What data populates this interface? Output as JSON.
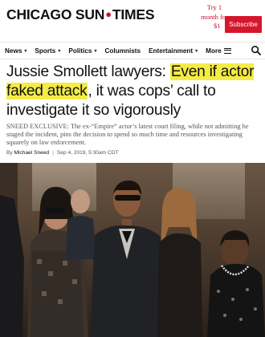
{
  "header": {
    "logo_left": "CHICAGO SUN",
    "logo_dot": "●",
    "logo_right": "TIMES",
    "promo_line1": "Try 1",
    "promo_line2": "month for",
    "promo_line3": "$1",
    "subscribe_label": "Subscribe"
  },
  "nav": {
    "items": [
      {
        "label": "News",
        "chevron": true
      },
      {
        "label": "Sports",
        "chevron": true
      },
      {
        "label": "Politics",
        "chevron": true
      },
      {
        "label": "Columnists",
        "chevron": false
      },
      {
        "label": "Entertainment",
        "chevron": true
      },
      {
        "label": "More",
        "chevron": false
      }
    ],
    "chevron_glyph": "▾"
  },
  "article": {
    "headline_part1": "Jussie Smollett lawyers: ",
    "headline_highlight": "Even if actor faked attack",
    "headline_part2": ", it was cops’ call to investigate it so vigorously",
    "dek": "SNEED EXCLUSIVE: The ex-“Empire” actor’s latest court filing, while not admitting he staged the incident, pins the decision to spend so much time and resources investigating squarely on law enforcement.",
    "byline_prefix": "By",
    "author": "Michael Sneed",
    "separator": "|",
    "date": "Sep 4, 2019, 5:30am CDT"
  },
  "colors": {
    "brand_red": "#c8102e",
    "subscribe_bg": "#d5162b",
    "highlight": "#f4ec46"
  },
  "icons": {
    "search": "search-icon",
    "menu": "hamburger-menu-icon"
  }
}
